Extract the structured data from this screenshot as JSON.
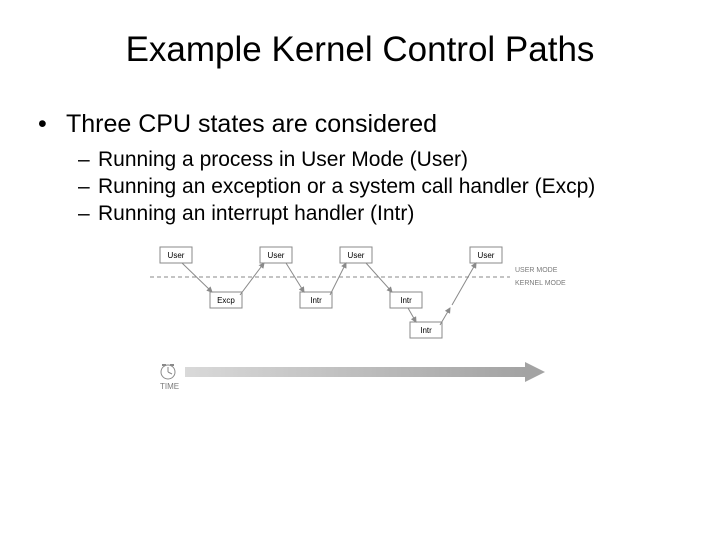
{
  "title": "Example Kernel Control Paths",
  "bullets": {
    "l1": "Three CPU states are considered",
    "l2a": "Running a process in User Mode (User)",
    "l2b": "Running an exception or a system call handler (Excp)",
    "l2c": "Running an interrupt handler (Intr)"
  },
  "diagram": {
    "top_boxes": [
      "User",
      "User",
      "User",
      "User"
    ],
    "mode_labels": {
      "upper": "USER MODE",
      "lower": "KERNEL MODE"
    },
    "bottom_boxes": {
      "excp": "Excp",
      "intr1": "Intr",
      "intr2": "Intr",
      "intr_nested": "Intr"
    },
    "time_label": "TIME"
  }
}
